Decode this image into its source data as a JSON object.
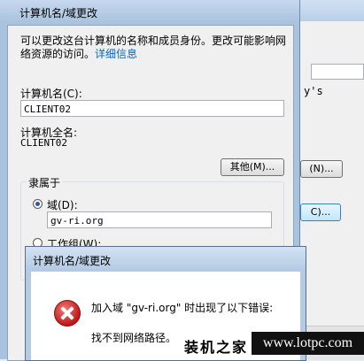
{
  "background_window": {
    "partial_text": "y's",
    "button1_label": "(N)...",
    "button2_label": "C)..."
  },
  "dialog": {
    "title": "计算机名/域更改",
    "description": "可以更改这台计算机的名称和成员身份。更改可能影响网络资源的访问。",
    "details_link": "详细信息",
    "computer_name_label": "计算机名(C):",
    "computer_name_value": "CLIENT02",
    "full_name_label": "计算机全名:",
    "full_name_value": "CLIENT02",
    "more_button": "其他(M)...",
    "member_of_label": "隶属于",
    "domain_radio_label": "域(D):",
    "domain_value": "gv-ri.org",
    "workgroup_radio_label": "工作组(W):"
  },
  "error_dialog": {
    "title": "计算机名/域更改",
    "message_line1": "加入域 \"gv-ri.org\" 时出现了以下错误:",
    "message_line2": "找不到网络路径。"
  },
  "watermark": {
    "brand_text": "装机之家",
    "url": "www.lotpc.com"
  }
}
